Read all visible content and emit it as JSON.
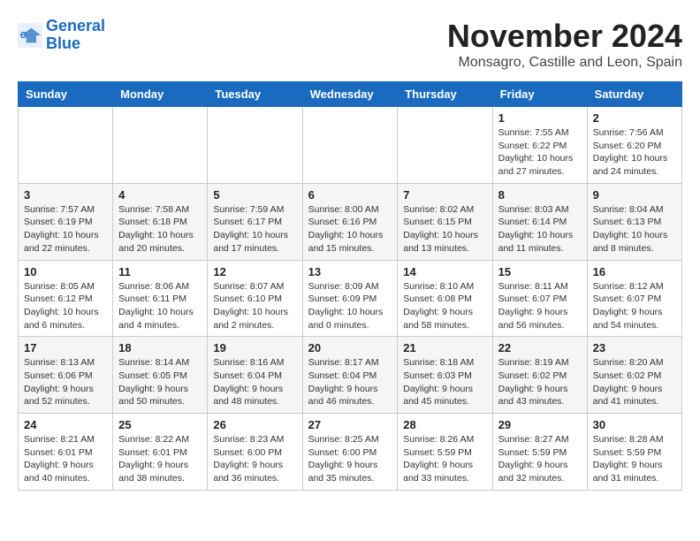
{
  "header": {
    "logo_line1": "General",
    "logo_line2": "Blue",
    "month_title": "November 2024",
    "location": "Monsagro, Castille and Leon, Spain"
  },
  "days_of_week": [
    "Sunday",
    "Monday",
    "Tuesday",
    "Wednesday",
    "Thursday",
    "Friday",
    "Saturday"
  ],
  "weeks": [
    [
      {
        "day": "",
        "info": ""
      },
      {
        "day": "",
        "info": ""
      },
      {
        "day": "",
        "info": ""
      },
      {
        "day": "",
        "info": ""
      },
      {
        "day": "",
        "info": ""
      },
      {
        "day": "1",
        "info": "Sunrise: 7:55 AM\nSunset: 6:22 PM\nDaylight: 10 hours and 27 minutes."
      },
      {
        "day": "2",
        "info": "Sunrise: 7:56 AM\nSunset: 6:20 PM\nDaylight: 10 hours and 24 minutes."
      }
    ],
    [
      {
        "day": "3",
        "info": "Sunrise: 7:57 AM\nSunset: 6:19 PM\nDaylight: 10 hours and 22 minutes."
      },
      {
        "day": "4",
        "info": "Sunrise: 7:58 AM\nSunset: 6:18 PM\nDaylight: 10 hours and 20 minutes."
      },
      {
        "day": "5",
        "info": "Sunrise: 7:59 AM\nSunset: 6:17 PM\nDaylight: 10 hours and 17 minutes."
      },
      {
        "day": "6",
        "info": "Sunrise: 8:00 AM\nSunset: 6:16 PM\nDaylight: 10 hours and 15 minutes."
      },
      {
        "day": "7",
        "info": "Sunrise: 8:02 AM\nSunset: 6:15 PM\nDaylight: 10 hours and 13 minutes."
      },
      {
        "day": "8",
        "info": "Sunrise: 8:03 AM\nSunset: 6:14 PM\nDaylight: 10 hours and 11 minutes."
      },
      {
        "day": "9",
        "info": "Sunrise: 8:04 AM\nSunset: 6:13 PM\nDaylight: 10 hours and 8 minutes."
      }
    ],
    [
      {
        "day": "10",
        "info": "Sunrise: 8:05 AM\nSunset: 6:12 PM\nDaylight: 10 hours and 6 minutes."
      },
      {
        "day": "11",
        "info": "Sunrise: 8:06 AM\nSunset: 6:11 PM\nDaylight: 10 hours and 4 minutes."
      },
      {
        "day": "12",
        "info": "Sunrise: 8:07 AM\nSunset: 6:10 PM\nDaylight: 10 hours and 2 minutes."
      },
      {
        "day": "13",
        "info": "Sunrise: 8:09 AM\nSunset: 6:09 PM\nDaylight: 10 hours and 0 minutes."
      },
      {
        "day": "14",
        "info": "Sunrise: 8:10 AM\nSunset: 6:08 PM\nDaylight: 9 hours and 58 minutes."
      },
      {
        "day": "15",
        "info": "Sunrise: 8:11 AM\nSunset: 6:07 PM\nDaylight: 9 hours and 56 minutes."
      },
      {
        "day": "16",
        "info": "Sunrise: 8:12 AM\nSunset: 6:07 PM\nDaylight: 9 hours and 54 minutes."
      }
    ],
    [
      {
        "day": "17",
        "info": "Sunrise: 8:13 AM\nSunset: 6:06 PM\nDaylight: 9 hours and 52 minutes."
      },
      {
        "day": "18",
        "info": "Sunrise: 8:14 AM\nSunset: 6:05 PM\nDaylight: 9 hours and 50 minutes."
      },
      {
        "day": "19",
        "info": "Sunrise: 8:16 AM\nSunset: 6:04 PM\nDaylight: 9 hours and 48 minutes."
      },
      {
        "day": "20",
        "info": "Sunrise: 8:17 AM\nSunset: 6:04 PM\nDaylight: 9 hours and 46 minutes."
      },
      {
        "day": "21",
        "info": "Sunrise: 8:18 AM\nSunset: 6:03 PM\nDaylight: 9 hours and 45 minutes."
      },
      {
        "day": "22",
        "info": "Sunrise: 8:19 AM\nSunset: 6:02 PM\nDaylight: 9 hours and 43 minutes."
      },
      {
        "day": "23",
        "info": "Sunrise: 8:20 AM\nSunset: 6:02 PM\nDaylight: 9 hours and 41 minutes."
      }
    ],
    [
      {
        "day": "24",
        "info": "Sunrise: 8:21 AM\nSunset: 6:01 PM\nDaylight: 9 hours and 40 minutes."
      },
      {
        "day": "25",
        "info": "Sunrise: 8:22 AM\nSunset: 6:01 PM\nDaylight: 9 hours and 38 minutes."
      },
      {
        "day": "26",
        "info": "Sunrise: 8:23 AM\nSunset: 6:00 PM\nDaylight: 9 hours and 36 minutes."
      },
      {
        "day": "27",
        "info": "Sunrise: 8:25 AM\nSunset: 6:00 PM\nDaylight: 9 hours and 35 minutes."
      },
      {
        "day": "28",
        "info": "Sunrise: 8:26 AM\nSunset: 5:59 PM\nDaylight: 9 hours and 33 minutes."
      },
      {
        "day": "29",
        "info": "Sunrise: 8:27 AM\nSunset: 5:59 PM\nDaylight: 9 hours and 32 minutes."
      },
      {
        "day": "30",
        "info": "Sunrise: 8:28 AM\nSunset: 5:59 PM\nDaylight: 9 hours and 31 minutes."
      }
    ]
  ]
}
